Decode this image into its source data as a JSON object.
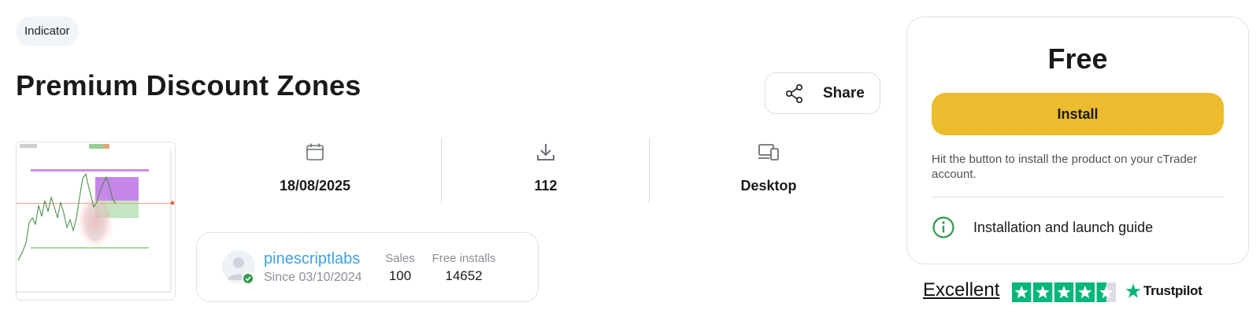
{
  "product": {
    "category": "Indicator",
    "title": "Premium Discount Zones",
    "share_label": "Share"
  },
  "stats": {
    "date": "18/08/2025",
    "downloads": "112",
    "platform": "Desktop"
  },
  "author": {
    "name": "pinescriptlabs",
    "since": "Since 03/10/2024",
    "sales_label": "Sales",
    "sales_value": "100",
    "free_installs_label": "Free installs",
    "free_installs_value": "14652"
  },
  "purchase": {
    "price": "Free",
    "install_label": "Install",
    "hint": "Hit the button to install the product on your cTrader account.",
    "guide_label": "Installation and launch guide"
  },
  "rating": {
    "label": "Excellent",
    "stars": 4.5,
    "brand": "Trustpilot"
  },
  "colors": {
    "accent_yellow": "#ecbc2e",
    "link_blue": "#3fa0e6",
    "trustpilot_green": "#00b67a",
    "verified_green": "#2f9a4a"
  },
  "icons": {
    "share": "share-icon",
    "date": "calendar-icon",
    "downloads": "download-icon",
    "platform": "devices-icon",
    "guide": "info-icon"
  }
}
